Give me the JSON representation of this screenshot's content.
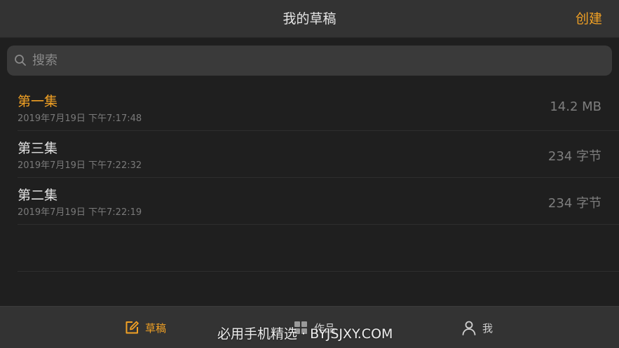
{
  "navbar": {
    "title": "我的草稿",
    "create_label": "创建"
  },
  "search": {
    "placeholder": "搜索",
    "value": ""
  },
  "drafts": [
    {
      "title": "第一集",
      "date": "2019年7月19日 下午7:17:48",
      "size": "14.2 MB",
      "selected": true
    },
    {
      "title": "第三集",
      "date": "2019年7月19日 下午7:22:32",
      "size": "234 字节",
      "selected": false
    },
    {
      "title": "第二集",
      "date": "2019年7月19日 下午7:22:19",
      "size": "234 字节",
      "selected": false
    }
  ],
  "tabs": [
    {
      "label": "草稿",
      "icon": "edit-icon",
      "active": true
    },
    {
      "label": "作品",
      "icon": "grid-icon",
      "active": false
    },
    {
      "label": "我",
      "icon": "person-icon",
      "active": false
    }
  ],
  "watermark": "必用手机精选 · BYJSJXY.COM",
  "colors": {
    "accent": "#f0a024",
    "background": "#1f1f1f",
    "bar": "#333333"
  }
}
